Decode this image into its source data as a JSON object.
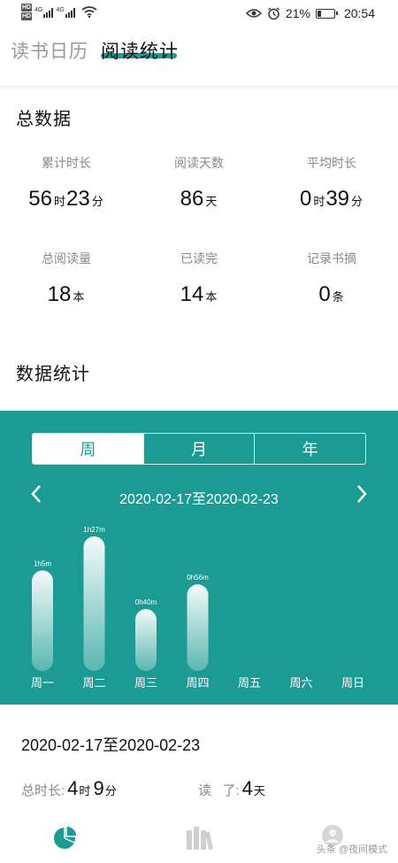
{
  "status_bar": {
    "hd1": "HD",
    "hd2": "HD",
    "sig1_label": "4G",
    "sig2_label": "4G",
    "battery_pct": "21%",
    "time": "20:54",
    "icons": [
      "eye-icon",
      "alarm-icon",
      "battery-icon",
      "wifi-icon",
      "signal-icon"
    ]
  },
  "top_tabs": [
    {
      "label": "读书日历",
      "active": false
    },
    {
      "label": "阅读统计",
      "active": true
    }
  ],
  "accent_color": "#1b9b93",
  "totals": {
    "title": "总数据",
    "items": [
      {
        "label": "累计时长",
        "parts": [
          {
            "n": "56",
            "u": "时"
          },
          {
            "n": "23",
            "u": "分"
          }
        ]
      },
      {
        "label": "阅读天数",
        "parts": [
          {
            "n": "86",
            "u": "天"
          }
        ]
      },
      {
        "label": "平均时长",
        "parts": [
          {
            "n": "0",
            "u": "时"
          },
          {
            "n": "39",
            "u": "分"
          }
        ]
      },
      {
        "label": "总阅读量",
        "parts": [
          {
            "n": "18",
            "u": "本"
          }
        ]
      },
      {
        "label": "已读完",
        "parts": [
          {
            "n": "14",
            "u": "本"
          }
        ]
      },
      {
        "label": "记录书摘",
        "parts": [
          {
            "n": "0",
            "u": "条"
          }
        ]
      }
    ]
  },
  "stats_title": "数据统计",
  "period_tabs": [
    {
      "label": "周",
      "selected": true
    },
    {
      "label": "月",
      "selected": false
    },
    {
      "label": "年",
      "selected": false
    }
  ],
  "range_label": "2020-02-17至2020-02-23",
  "chart_data": {
    "type": "bar",
    "categories": [
      "周一",
      "周二",
      "周三",
      "周四",
      "周五",
      "周六",
      "周日"
    ],
    "values": [
      65,
      87,
      40,
      56,
      0,
      0,
      0
    ],
    "value_unit": "minutes",
    "data_labels": [
      "1h5m",
      "1h27m",
      "0h40m",
      "0h56m",
      "",
      "",
      ""
    ],
    "title": "",
    "xlabel": "",
    "ylabel": "",
    "ylim": [
      0,
      87
    ],
    "grid": false
  },
  "summary": {
    "range": "2020-02-17至2020-02-23",
    "total_label": "总时长:",
    "total_hours": "4",
    "total_hours_unit": "时",
    "total_minutes": "9",
    "total_minutes_unit": "分",
    "read_label": "读   了:",
    "read_days": "4",
    "read_days_unit": "天"
  },
  "bottom_nav": [
    "pie-chart-icon",
    "books-icon",
    "profile-icon"
  ],
  "watermark": "头条 @夜间模式"
}
